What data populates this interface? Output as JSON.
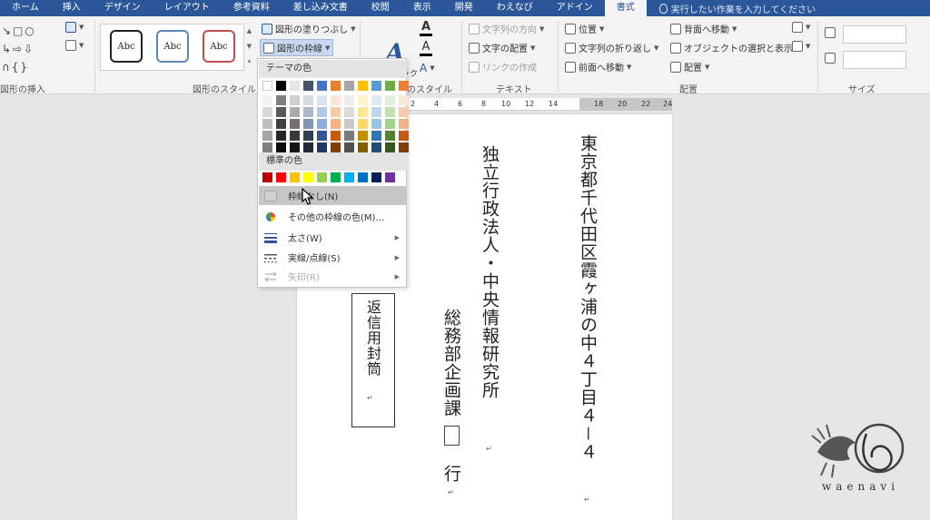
{
  "tabs": [
    "ホーム",
    "挿入",
    "デザイン",
    "レイアウト",
    "参考資料",
    "差し込み文書",
    "校閲",
    "表示",
    "開発",
    "わえなび",
    "アドイン",
    "書式"
  ],
  "active_tab": "書式",
  "tell_me": "実行したい作業を入力してください",
  "ribbon": {
    "insert_shapes_label": "図形の挿入",
    "shape_styles_label": "図形のスタイル",
    "style_sample": "Abc",
    "fill_button": "図形の塗りつぶし",
    "outline_button": "図形の枠線",
    "wordart_label": "のスタイル",
    "quick_styles": "クイック",
    "text_direction": "文字列の方向",
    "text_align": "文字の配置",
    "create_link": "リンクの作成",
    "text_label": "テキスト",
    "position": "位置",
    "wrap_text": "文字列の折り返し",
    "bring_forward": "前面へ移動",
    "send_backward": "背面へ移動",
    "selection_pane": "オブジェクトの選択と表示",
    "align": "配置",
    "arrange_label": "配置",
    "size_label": "サイズ"
  },
  "ruler_ticks": [
    "2",
    "4",
    "6",
    "8",
    "10",
    "12",
    "14",
    "18",
    "20",
    "22",
    "24"
  ],
  "menu": {
    "theme_colors_label": "テーマの色",
    "standard_colors_label": "標準の色",
    "items": [
      {
        "label": "枠線なし(N)",
        "enabled": true
      },
      {
        "label": "その他の枠線の色(M)...",
        "enabled": true
      },
      {
        "label": "太さ(W)",
        "enabled": true
      },
      {
        "label": "実線/点線(S)",
        "enabled": true
      },
      {
        "label": "矢印(R)",
        "enabled": false
      }
    ],
    "theme_top": [
      "#ffffff",
      "#000000",
      "#e7e6e6",
      "#44546a",
      "#4472c4",
      "#ed7d31",
      "#a5a5a5",
      "#ffc000",
      "#5b9bd5",
      "#70ad47",
      "#ed7d31"
    ],
    "theme_cols": [
      [
        "#f2f2f2",
        "#d9d9d9",
        "#bfbfbf",
        "#a6a6a6",
        "#808080"
      ],
      [
        "#7f7f7f",
        "#595959",
        "#404040",
        "#262626",
        "#0d0d0d"
      ],
      [
        "#d0cece",
        "#aeaaaa",
        "#757171",
        "#3a3838",
        "#171616"
      ],
      [
        "#d6dce4",
        "#adb9ca",
        "#8497b0",
        "#333f4f",
        "#222a35"
      ],
      [
        "#dae3f3",
        "#b4c7e7",
        "#8faadc",
        "#2f5597",
        "#203864"
      ],
      [
        "#fbe5d6",
        "#f8cbad",
        "#f4b183",
        "#c55a11",
        "#843c0c"
      ],
      [
        "#ededed",
        "#dbdbdb",
        "#c9c9c9",
        "#7b7b7b",
        "#525252"
      ],
      [
        "#fff2cc",
        "#ffe699",
        "#ffd966",
        "#bf9000",
        "#7f6000"
      ],
      [
        "#deebf7",
        "#bdd7ee",
        "#9dc3e6",
        "#2e75b6",
        "#1f4e79"
      ],
      [
        "#e2f0d9",
        "#c5e0b4",
        "#a9d18e",
        "#548235",
        "#385723"
      ],
      [
        "#fbe5d6",
        "#f8cbad",
        "#f4b183",
        "#c55a11",
        "#843c0c"
      ]
    ],
    "standard": [
      "#c00000",
      "#ff0000",
      "#ffc000",
      "#ffff00",
      "#92d050",
      "#00b050",
      "#00b0f0",
      "#0070c0",
      "#002060",
      "#7030a0"
    ]
  },
  "document": {
    "address": "東京都千代田区霞ヶ浦の中４丁目４－４",
    "org": "独立行政法人・中央情報研究所",
    "dept": "総務部企画課",
    "suffix": "行",
    "return_label": "返信用封筒"
  },
  "logo_text": "waenavi"
}
